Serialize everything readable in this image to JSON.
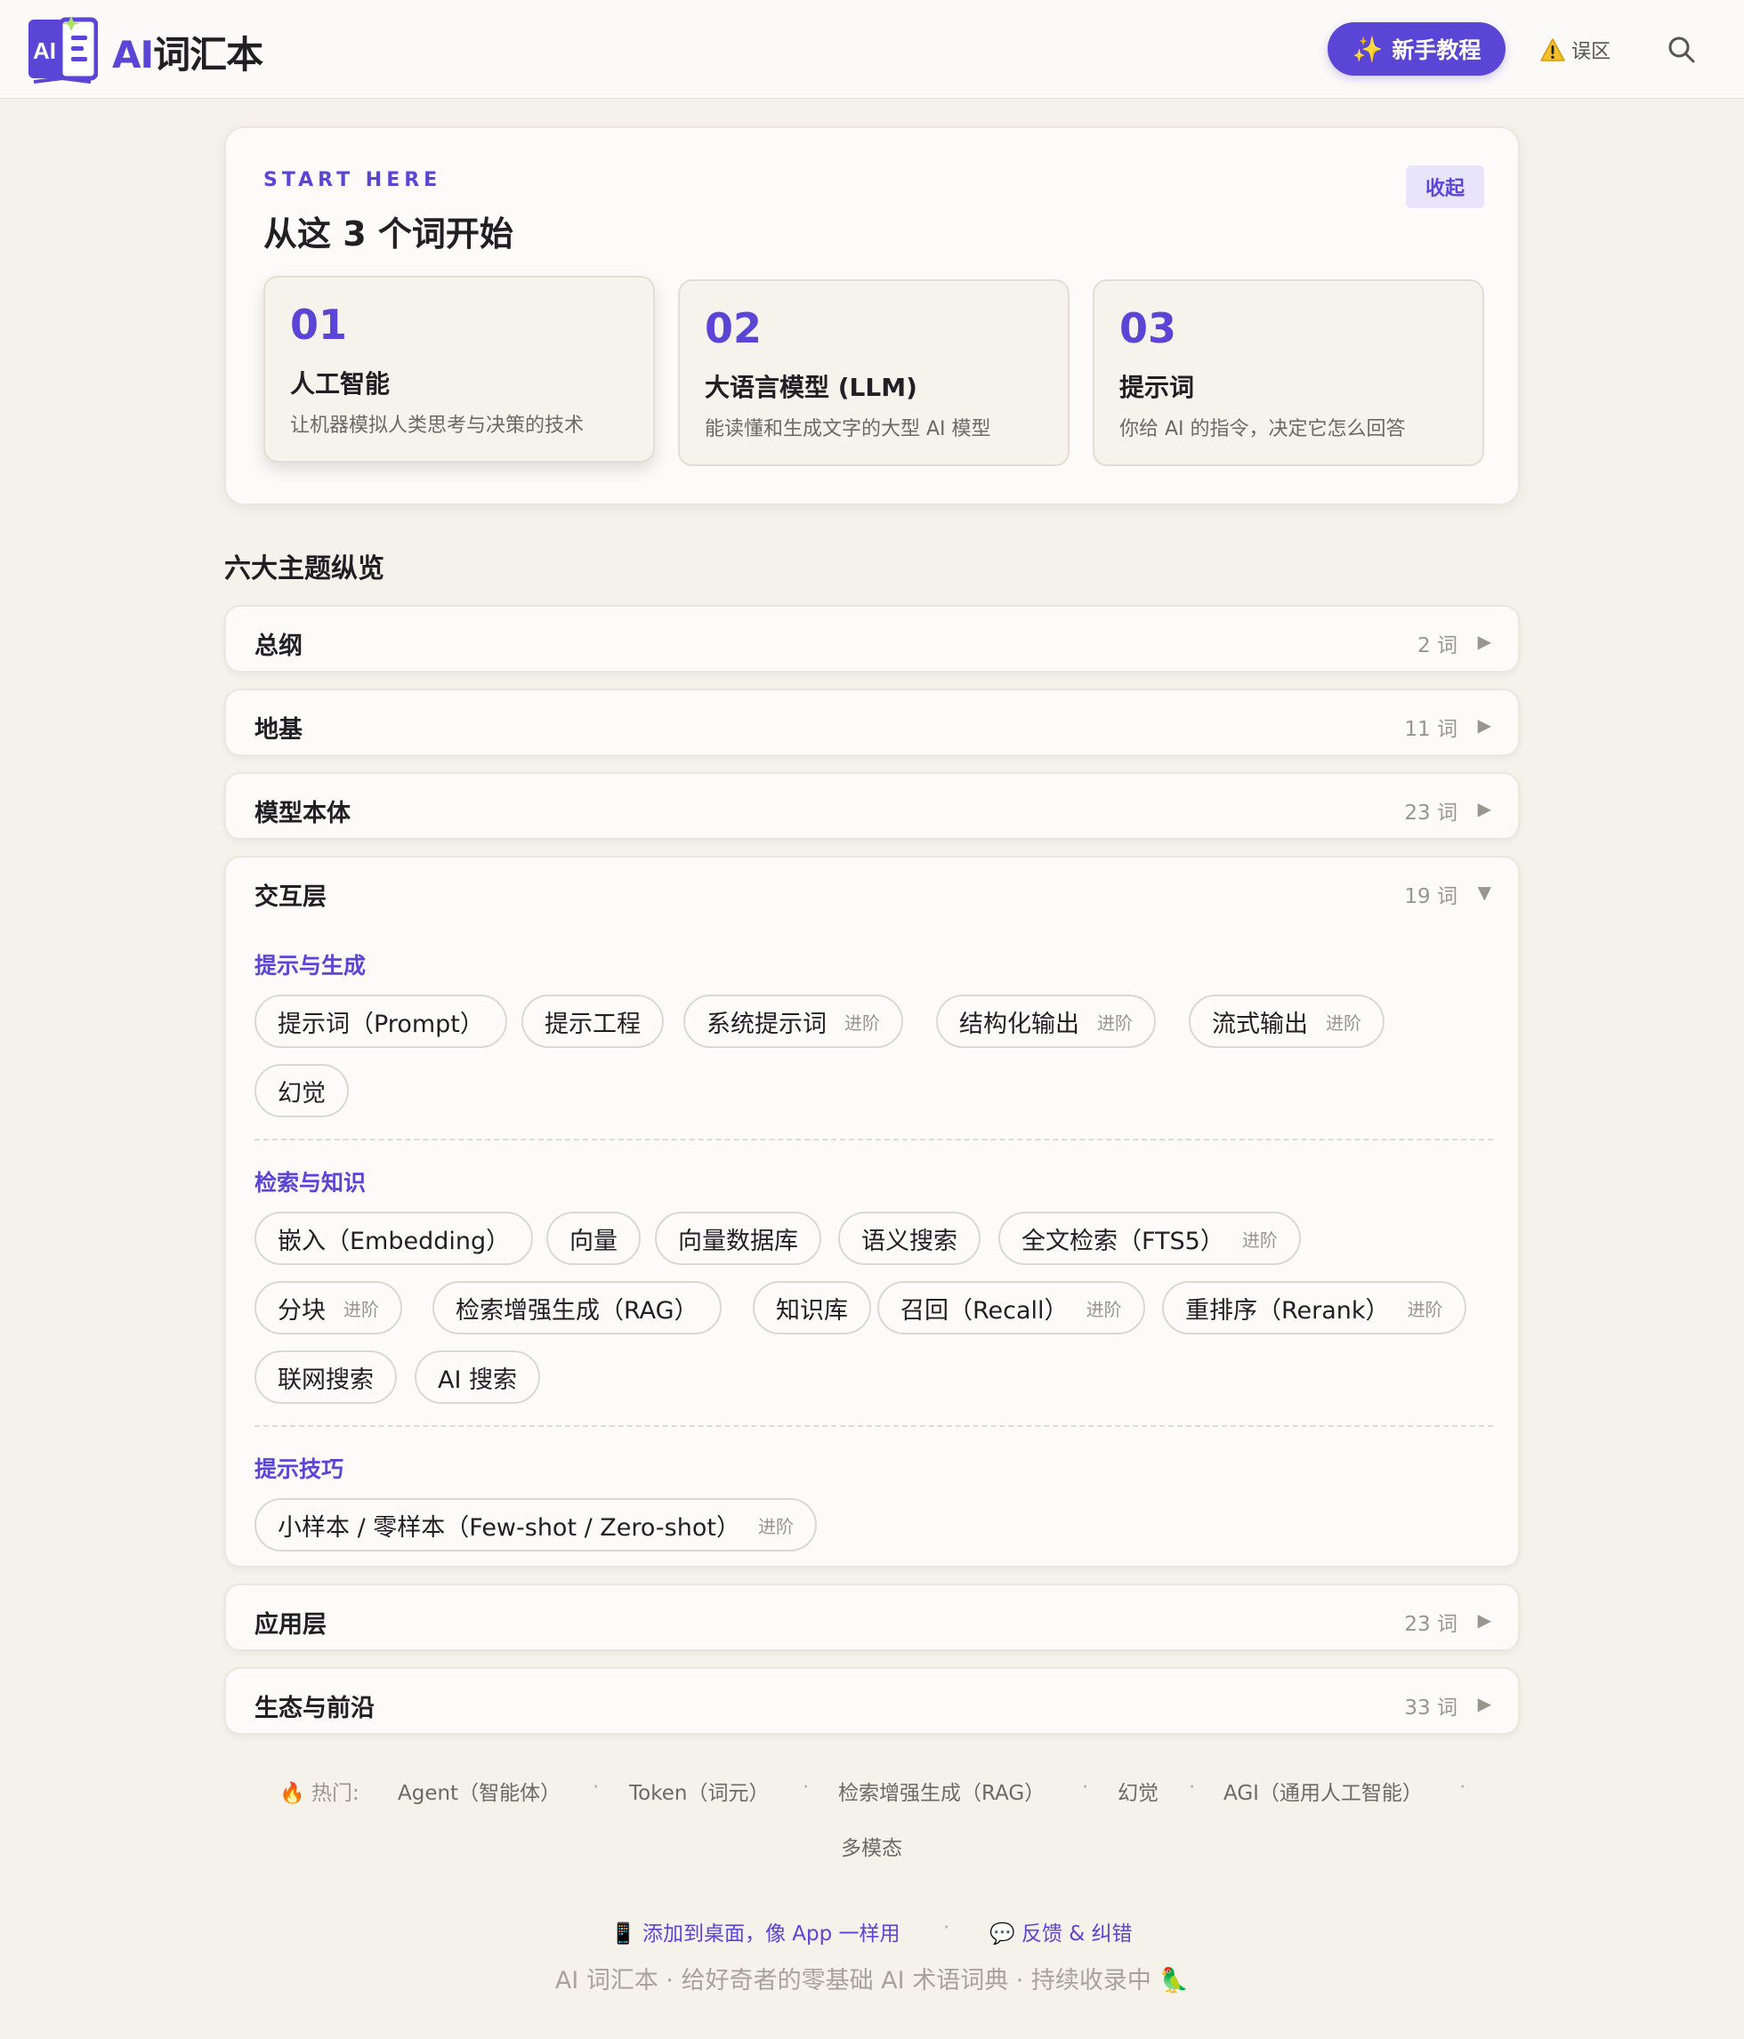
{
  "header": {
    "brand_ai": "AI",
    "brand_rest": "词汇本",
    "tutorial_label": "新手教程",
    "pitfalls_label": "误区"
  },
  "start": {
    "eyebrow": "START HERE",
    "title": "从这 3 个词开始",
    "collapse_label": "收起",
    "items": [
      {
        "num": "01",
        "word": "人工智能",
        "desc": "让机器模拟人类思考与决策的技术"
      },
      {
        "num": "02",
        "word": "大语言模型 (LLM)",
        "desc": "能读懂和生成文字的大型 AI 模型"
      },
      {
        "num": "03",
        "word": "提示词",
        "desc": "你给 AI 的指令，决定它怎么回答"
      }
    ]
  },
  "topics_heading": "六大主题纵览",
  "topics": [
    {
      "name": "总纲",
      "count": "2 词",
      "arrow": "▶"
    },
    {
      "name": "地基",
      "count": "11 词",
      "arrow": "▶"
    },
    {
      "name": "模型本体",
      "count": "23 词",
      "arrow": "▶"
    },
    {
      "name": "交互层",
      "count": "19 词",
      "arrow": "▼"
    },
    {
      "name": "应用层",
      "count": "23 词",
      "arrow": "▶"
    },
    {
      "name": "生态与前沿",
      "count": "33 词",
      "arrow": "▶"
    }
  ],
  "interaction": {
    "advanced_tag": "进阶",
    "groups": [
      {
        "title": "提示与生成",
        "terms": [
          {
            "label": "提示词（Prompt）"
          },
          {
            "label": "提示工程"
          },
          {
            "label": "系统提示词",
            "advanced": true
          },
          {
            "label": "结构化输出",
            "advanced": true
          },
          {
            "label": "流式输出",
            "advanced": true
          },
          {
            "label": "幻觉"
          }
        ]
      },
      {
        "title": "检索与知识",
        "terms": [
          {
            "label": "嵌入（Embedding）"
          },
          {
            "label": "向量"
          },
          {
            "label": "向量数据库"
          },
          {
            "label": "语义搜索"
          },
          {
            "label": "全文检索（FTS5）",
            "advanced": true
          },
          {
            "label": "分块",
            "advanced": true
          },
          {
            "label": "检索增强生成（RAG）"
          },
          {
            "label": "知识库"
          },
          {
            "label": "召回（Recall）",
            "advanced": true
          },
          {
            "label": "重排序（Rerank）",
            "advanced": true
          },
          {
            "label": "联网搜索"
          },
          {
            "label": "AI 搜索"
          }
        ]
      },
      {
        "title": "提示技巧",
        "terms": [
          {
            "label": "小样本 / 零样本（Few-shot / Zero-shot）",
            "advanced": true
          }
        ]
      }
    ]
  },
  "footer": {
    "hot_label": "热门:",
    "hot_items": [
      "Agent（智能体）",
      "Token（词元）",
      "检索增强生成（RAG）",
      "幻觉",
      "AGI（通用人工智能）",
      "多模态"
    ],
    "add_to_desktop": "添加到桌面，像 App 一样用",
    "feedback": "反馈 & 纠错",
    "tagline": "AI 词汇本 · 给好奇者的零基础 AI 术语词典 · 持续收录中"
  },
  "colors": {
    "accent": "#5b45d6",
    "background": "#f5f2ec",
    "card": "#fcfbf9"
  },
  "icons": [
    "book-logo-icon",
    "sparkles-icon",
    "warning-icon",
    "search-icon",
    "fire-icon",
    "phone-icon",
    "speech-bubble-icon",
    "parrot-icon"
  ]
}
